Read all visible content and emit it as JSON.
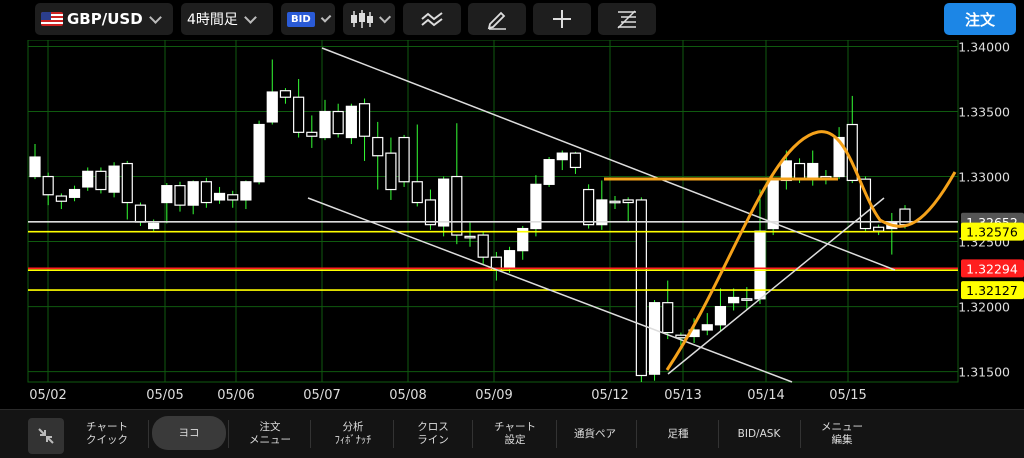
{
  "toolbar": {
    "pair": "GBP/USD",
    "timeframe": "4時間足",
    "price_type": "BID",
    "chart_type_icon": "candlestick-icon",
    "tool_icons": [
      "indicator-icon",
      "pencil-icon",
      "crosshair-icon",
      "fibonacci-icon"
    ],
    "order_label": "注文"
  },
  "chart_data": {
    "type": "candlestick",
    "ylim": [
      1.3142,
      1.3405
    ],
    "y_ticks": [
      "1.34000",
      "1.33500",
      "1.33000",
      "1.32500",
      "1.32000",
      "1.31500"
    ],
    "x_labels": [
      "05/02",
      "05/05",
      "05/06",
      "05/07",
      "05/08",
      "05/09",
      "05/12",
      "05/13",
      "05/14",
      "05/15"
    ],
    "grid": true,
    "colors": {
      "background": "#000000",
      "grid": "#0f5a0f",
      "up_candle": "#ffffff",
      "down_candle": "#ffffff",
      "wick": "#35ff35",
      "yellow_line": "#ffff00",
      "red_line": "#ff1e1e",
      "white_line": "#dddddd",
      "orange_line": "#f5a21a"
    },
    "candles": [
      [
        1.33,
        1.3315,
        1.3298,
        1.3325
      ],
      [
        1.33,
        1.3286,
        1.3278,
        1.3303
      ],
      [
        1.3285,
        1.3281,
        1.3275,
        1.3287
      ],
      [
        1.3284,
        1.329,
        1.3281,
        1.3293
      ],
      [
        1.3292,
        1.3304,
        1.3289,
        1.3307
      ],
      [
        1.3304,
        1.329,
        1.3287,
        1.3307
      ],
      [
        1.3288,
        1.3308,
        1.3284,
        1.3311
      ],
      [
        1.331,
        1.328,
        1.3267,
        1.3312
      ],
      [
        1.3278,
        1.3265,
        1.3262,
        1.328
      ],
      [
        1.326,
        1.3264,
        1.3257,
        1.3267
      ],
      [
        1.328,
        1.3293,
        1.3264,
        1.3295
      ],
      [
        1.3293,
        1.3278,
        1.3273,
        1.3296
      ],
      [
        1.3278,
        1.3296,
        1.3271,
        1.3297
      ],
      [
        1.3296,
        1.328,
        1.3276,
        1.3299
      ],
      [
        1.3282,
        1.3287,
        1.3279,
        1.3292
      ],
      [
        1.3286,
        1.3282,
        1.3276,
        1.3289
      ],
      [
        1.3282,
        1.3296,
        1.3275,
        1.3297
      ],
      [
        1.3296,
        1.334,
        1.3294,
        1.3343
      ],
      [
        1.3342,
        1.3365,
        1.334,
        1.339
      ],
      [
        1.3366,
        1.3361,
        1.3356,
        1.3368
      ],
      [
        1.3361,
        1.3334,
        1.333,
        1.3375
      ],
      [
        1.3334,
        1.3331,
        1.3322,
        1.3347
      ],
      [
        1.333,
        1.335,
        1.3328,
        1.3359
      ],
      [
        1.335,
        1.3333,
        1.333,
        1.3356
      ],
      [
        1.333,
        1.3354,
        1.3325,
        1.3356
      ],
      [
        1.3356,
        1.3331,
        1.3312,
        1.336
      ],
      [
        1.333,
        1.3316,
        1.329,
        1.3342
      ],
      [
        1.3318,
        1.329,
        1.3282,
        1.333
      ],
      [
        1.333,
        1.3296,
        1.3292,
        1.3332
      ],
      [
        1.3296,
        1.328,
        1.3277,
        1.334
      ],
      [
        1.3282,
        1.3263,
        1.3259,
        1.329
      ],
      [
        1.3262,
        1.3298,
        1.3254,
        1.33
      ],
      [
        1.33,
        1.3255,
        1.3248,
        1.3341
      ],
      [
        1.3254,
        1.3253,
        1.3246,
        1.3265
      ],
      [
        1.3255,
        1.3238,
        1.3232,
        1.3257
      ],
      [
        1.3238,
        1.3228,
        1.322,
        1.3242
      ],
      [
        1.323,
        1.3243,
        1.3226,
        1.3246
      ],
      [
        1.3243,
        1.326,
        1.3236,
        1.3262
      ],
      [
        1.326,
        1.3294,
        1.3254,
        1.3301
      ],
      [
        1.3294,
        1.3313,
        1.3292,
        1.3315
      ],
      [
        1.3313,
        1.3318,
        1.3305,
        1.332
      ],
      [
        1.3318,
        1.3307,
        1.3302,
        1.3319
      ],
      [
        1.329,
        1.3263,
        1.326,
        1.3294
      ],
      [
        1.3263,
        1.3282,
        1.3259,
        1.3297
      ],
      [
        1.3281,
        1.328,
        1.3275,
        1.3285
      ],
      [
        1.3282,
        1.328,
        1.3265,
        1.3284
      ],
      [
        1.3282,
        1.3147,
        1.3142,
        1.3284
      ],
      [
        1.3148,
        1.3203,
        1.3143,
        1.3205
      ],
      [
        1.3203,
        1.318,
        1.3175,
        1.322
      ],
      [
        1.3178,
        1.3176,
        1.317,
        1.318
      ],
      [
        1.3177,
        1.3182,
        1.3172,
        1.3191
      ],
      [
        1.3182,
        1.3186,
        1.3178,
        1.3195
      ],
      [
        1.3186,
        1.32,
        1.3181,
        1.3214
      ],
      [
        1.3203,
        1.3207,
        1.3197,
        1.3214
      ],
      [
        1.3206,
        1.3205,
        1.3198,
        1.3215
      ],
      [
        1.3206,
        1.3258,
        1.3202,
        1.329
      ],
      [
        1.326,
        1.3297,
        1.3255,
        1.3299
      ],
      [
        1.3297,
        1.3312,
        1.329,
        1.332
      ],
      [
        1.331,
        1.3298,
        1.3295,
        1.3314
      ],
      [
        1.3298,
        1.331,
        1.3293,
        1.332
      ],
      [
        1.33,
        1.3299,
        1.3294,
        1.3305
      ],
      [
        1.33,
        1.333,
        1.3298,
        1.3338
      ],
      [
        1.334,
        1.3297,
        1.3295,
        1.3362
      ],
      [
        1.3298,
        1.326,
        1.3257,
        1.33
      ],
      [
        1.3261,
        1.3258,
        1.3255,
        1.3263
      ],
      [
        1.326,
        1.3265,
        1.324,
        1.3272
      ],
      [
        1.3275,
        1.3263,
        1.326,
        1.3278
      ]
    ],
    "horizontal_lines": [
      {
        "price": 1.32652,
        "color": "#dddddd",
        "label": "1.32652",
        "label_bg": "#555555",
        "label_color": "#ffffff"
      },
      {
        "price": 1.32576,
        "color": "#ffff00",
        "label": "1.32576",
        "label_bg": "#ffff00",
        "label_color": "#000000"
      },
      {
        "price": 1.32294,
        "color": "#ff1e1e",
        "label": "1.32294",
        "label_bg": "#ff1e1e",
        "label_color": "#ffffff"
      },
      {
        "price": 1.3228,
        "color": "#ffff00",
        "label": "",
        "label_bg": "",
        "label_color": ""
      },
      {
        "price": 1.32127,
        "color": "#ffff00",
        "label": "1.32127",
        "label_bg": "#ffff00",
        "label_color": "#000000"
      }
    ]
  },
  "bottom_nav": [
    {
      "name": "nav-chart-quick",
      "label": "チャート\nクイック"
    },
    {
      "name": "nav-yoko",
      "label": "ヨコ"
    },
    {
      "name": "nav-order-menu",
      "label": "注文\nメニュー"
    },
    {
      "name": "nav-analysis-fibonacci",
      "label": "分析\nﾌｨﾎﾞﾅｯﾁ"
    },
    {
      "name": "nav-cross-line",
      "label": "クロス\nライン"
    },
    {
      "name": "nav-chart-settings",
      "label": "チャート\n設定"
    },
    {
      "name": "nav-currency-pair",
      "label": "通貨ペア"
    },
    {
      "name": "nav-timeframe",
      "label": "足種"
    },
    {
      "name": "nav-bid-ask",
      "label": "BID/ASK"
    },
    {
      "name": "nav-menu-edit",
      "label": "メニュー\n編集"
    }
  ]
}
